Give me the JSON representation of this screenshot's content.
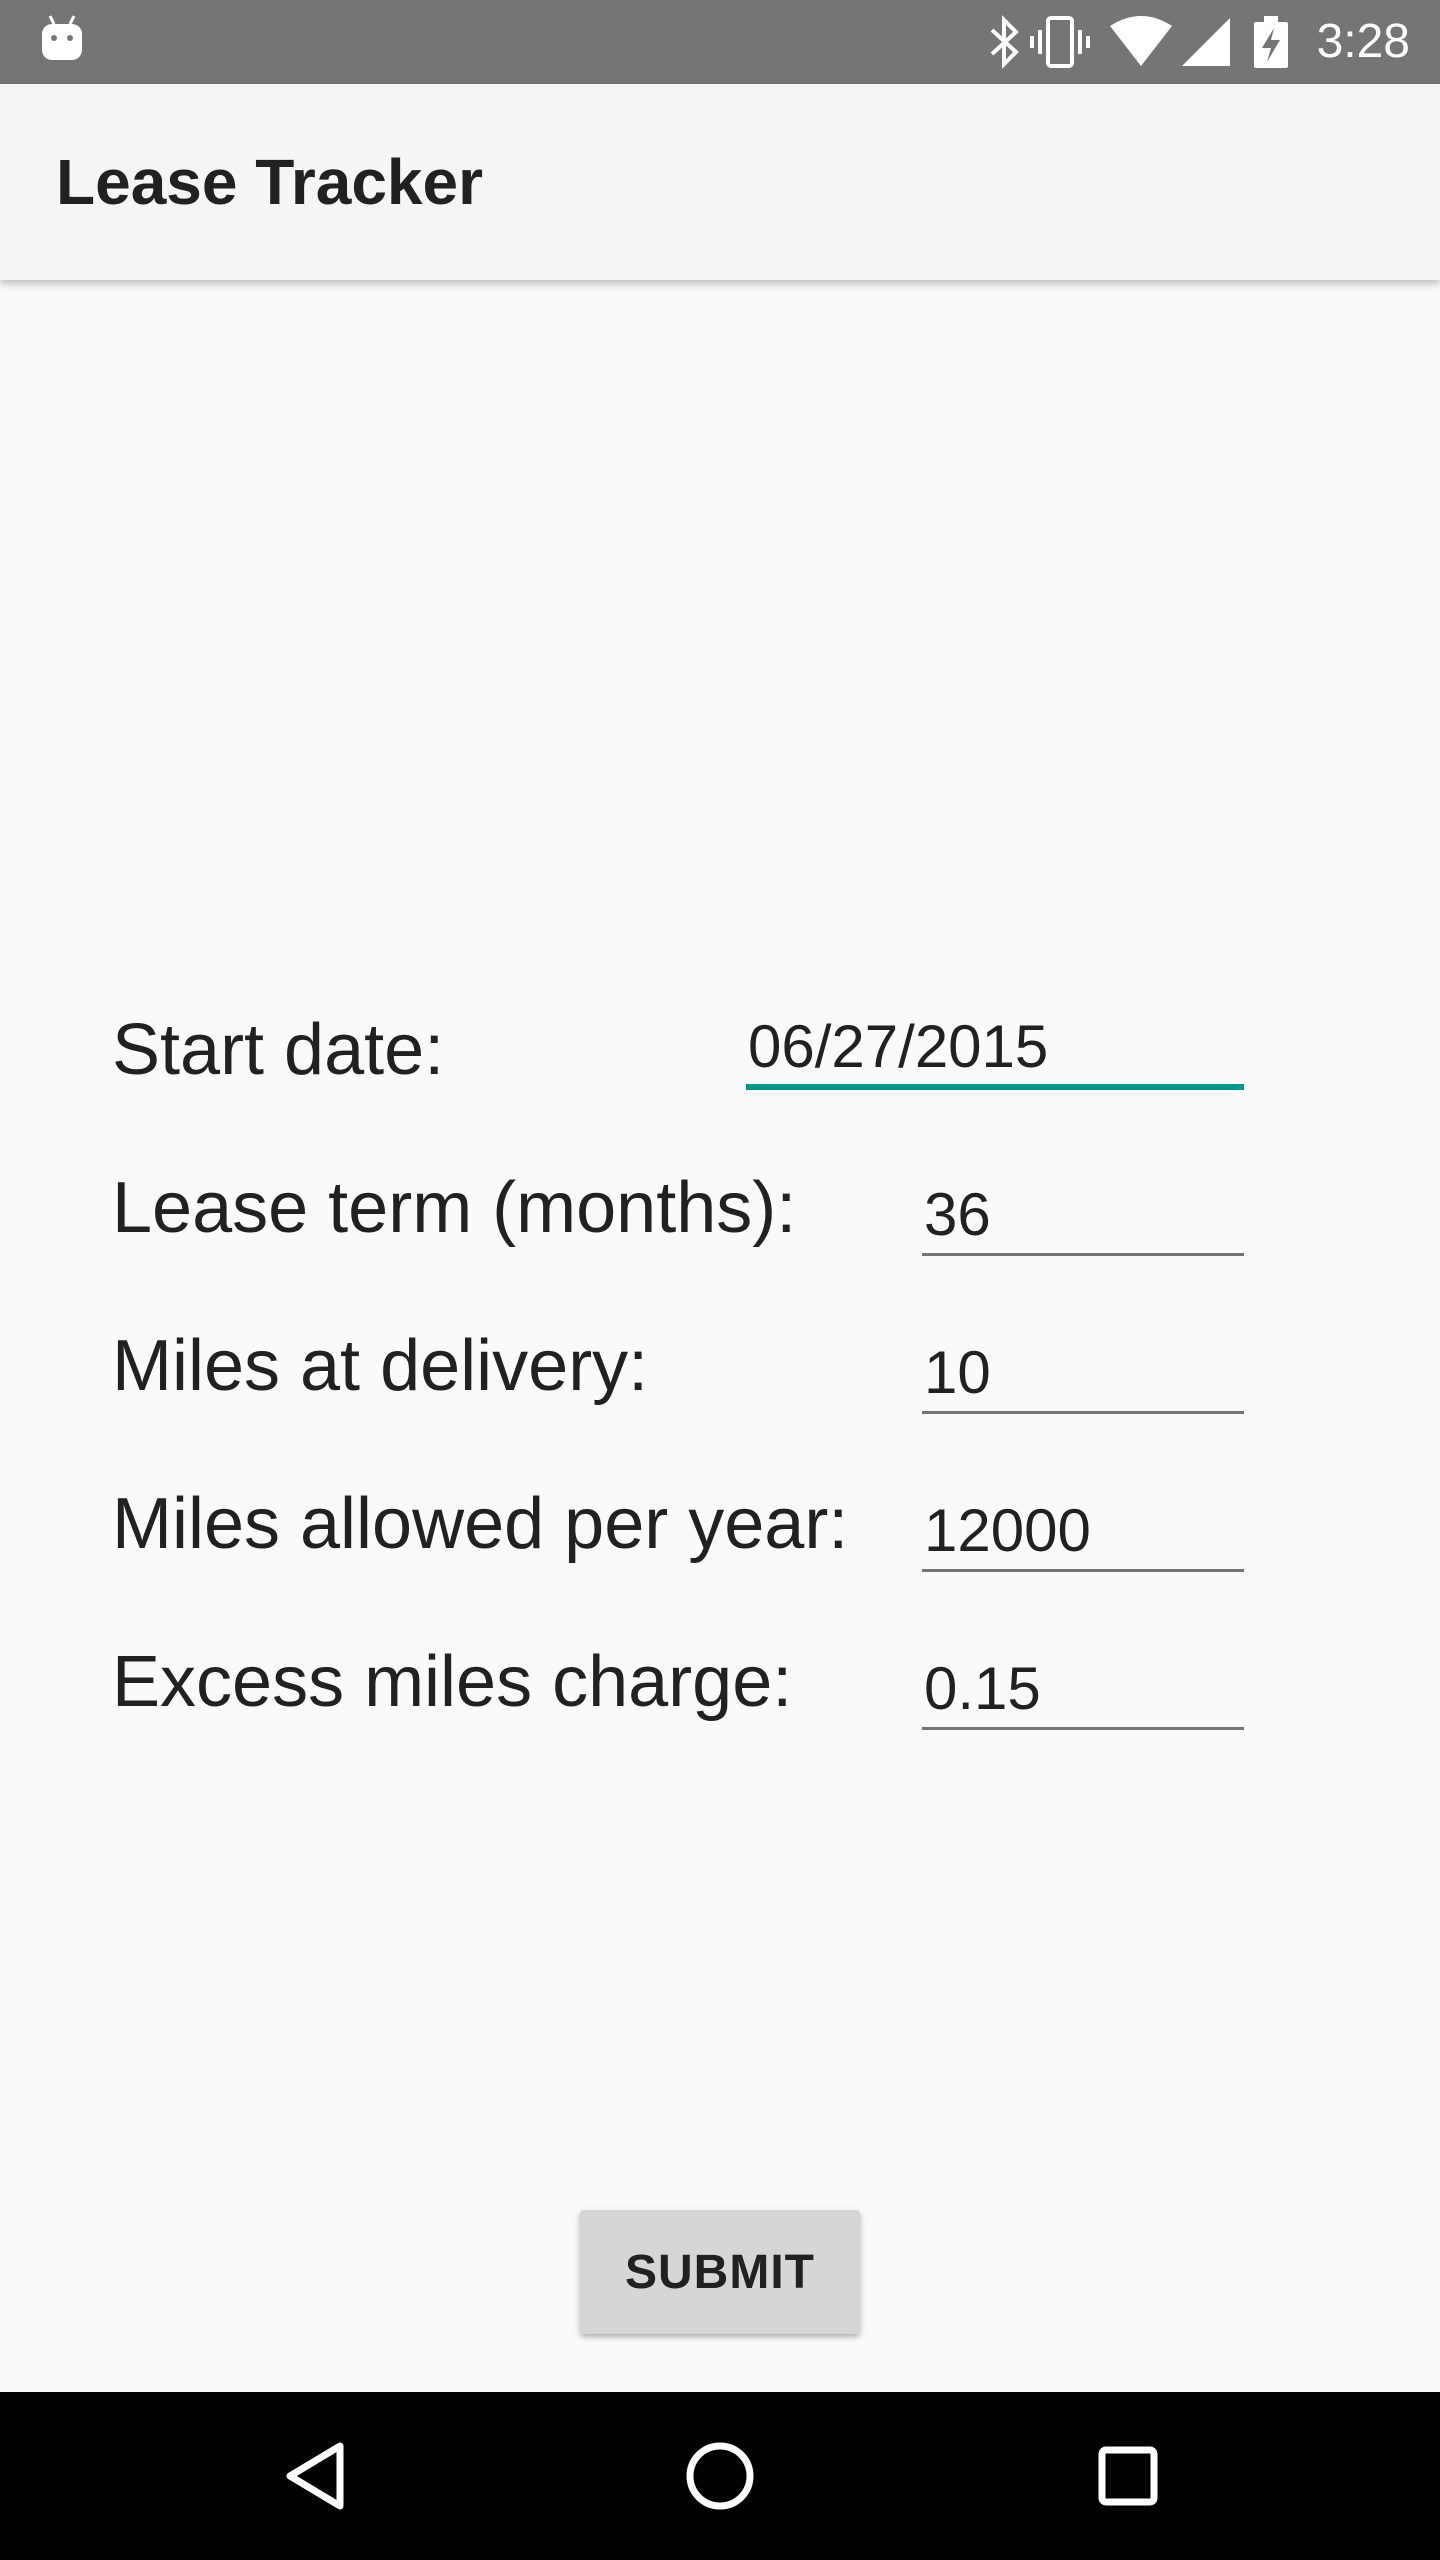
{
  "status_bar": {
    "time": "3:28",
    "icons": [
      "android-icon",
      "bluetooth-icon",
      "vibrate-icon",
      "wifi-icon",
      "signal-icon",
      "battery-charging-icon"
    ]
  },
  "app_bar": {
    "title": "Lease Tracker"
  },
  "form": {
    "start_date": {
      "label": "Start date:",
      "value": "06/27/2015"
    },
    "lease_term": {
      "label": "Lease term (months):",
      "value": "36"
    },
    "miles_at_delivery": {
      "label": "Miles at delivery:",
      "value": "10"
    },
    "miles_per_year": {
      "label": "Miles allowed per year:",
      "value": "12000"
    },
    "excess_charge": {
      "label": "Excess miles charge:",
      "value": "0.15"
    }
  },
  "submit_label": "SUBMIT",
  "nav_bar": {
    "icons": [
      "back-icon",
      "home-icon",
      "recents-icon"
    ]
  },
  "colors": {
    "accent": "#009688",
    "status_bar": "#757575",
    "app_bar": "#f5f5f5",
    "background": "#fafafa"
  }
}
